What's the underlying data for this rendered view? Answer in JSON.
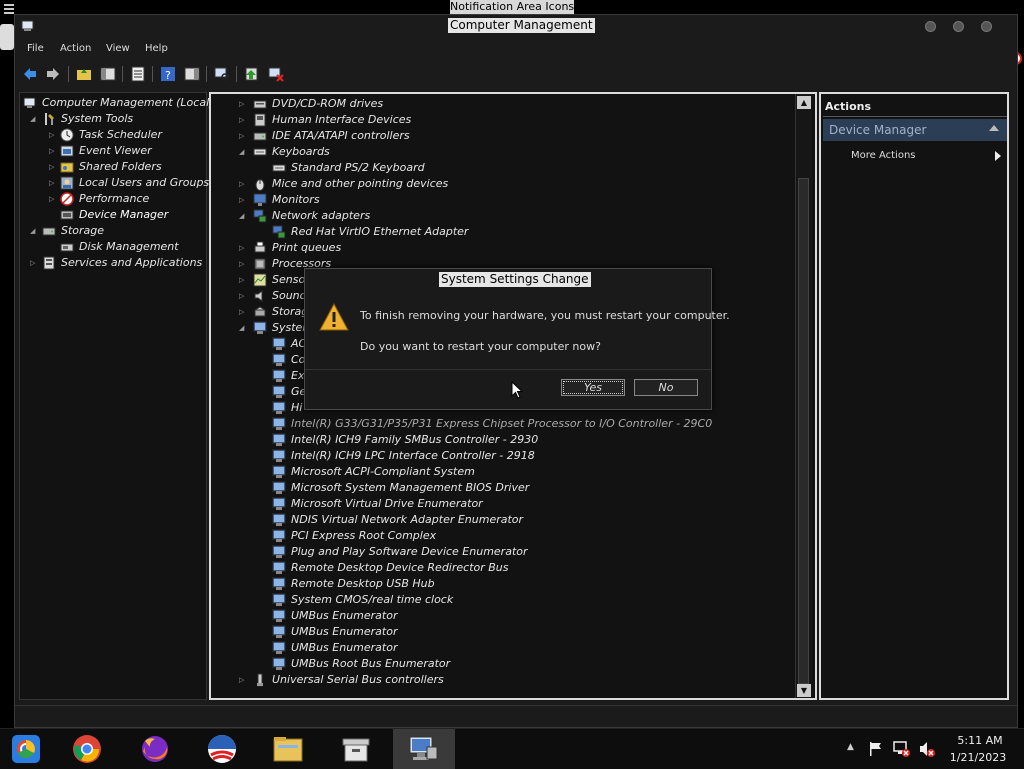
{
  "background": {
    "notification_tab": "Notification Area Icons"
  },
  "window": {
    "title": "Computer Management",
    "menu": [
      "File",
      "Action",
      "View",
      "Help"
    ]
  },
  "left_tree": [
    {
      "label": "Computer Management (Local)",
      "icon": "computer-management-icon"
    },
    {
      "label": "System Tools",
      "icon": "system-tools-icon"
    },
    {
      "label": "Task Scheduler",
      "icon": "task-scheduler-icon"
    },
    {
      "label": "Event Viewer",
      "icon": "event-viewer-icon"
    },
    {
      "label": "Shared Folders",
      "icon": "shared-folders-icon"
    },
    {
      "label": "Local Users and Groups",
      "icon": "local-users-icon"
    },
    {
      "label": "Performance",
      "icon": "performance-icon"
    },
    {
      "label": "Device Manager",
      "icon": "device-manager-icon"
    },
    {
      "label": "Storage",
      "icon": "storage-icon"
    },
    {
      "label": "Disk Management",
      "icon": "disk-management-icon"
    },
    {
      "label": "Services and Applications",
      "icon": "services-icon"
    }
  ],
  "device_tree": [
    {
      "label": "DVD/CD-ROM drives"
    },
    {
      "label": "Human Interface Devices"
    },
    {
      "label": "IDE ATA/ATAPI controllers"
    },
    {
      "label": "Keyboards"
    },
    {
      "label": "Standard PS/2 Keyboard"
    },
    {
      "label": "Mice and other pointing devices"
    },
    {
      "label": "Monitors"
    },
    {
      "label": "Network adapters"
    },
    {
      "label": "Red Hat VirtIO Ethernet Adapter"
    },
    {
      "label": "Print queues"
    },
    {
      "label": "Processors"
    },
    {
      "label": "Senso"
    },
    {
      "label": "Sound"
    },
    {
      "label": "Storag"
    },
    {
      "label": "Syster"
    },
    {
      "label": "AC"
    },
    {
      "label": "Co"
    },
    {
      "label": "Ex"
    },
    {
      "label": "Ge"
    },
    {
      "label": "Hi"
    },
    {
      "label": "Intel(R) G33/G31/P35/P31 Express Chipset Processor to I/O Controller - 29C0"
    },
    {
      "label": "Intel(R) ICH9 Family SMBus Controller - 2930"
    },
    {
      "label": "Intel(R) ICH9 LPC Interface Controller - 2918"
    },
    {
      "label": "Microsoft ACPI-Compliant System"
    },
    {
      "label": "Microsoft System Management BIOS Driver"
    },
    {
      "label": "Microsoft Virtual Drive Enumerator"
    },
    {
      "label": "NDIS Virtual Network Adapter Enumerator"
    },
    {
      "label": "PCI Express Root Complex"
    },
    {
      "label": "Plug and Play Software Device Enumerator"
    },
    {
      "label": "Remote Desktop Device Redirector Bus"
    },
    {
      "label": "Remote Desktop USB Hub"
    },
    {
      "label": "System CMOS/real time clock"
    },
    {
      "label": "UMBus Enumerator"
    },
    {
      "label": "UMBus Enumerator"
    },
    {
      "label": "UMBus Enumerator"
    },
    {
      "label": "UMBus Root Bus Enumerator"
    },
    {
      "label": "Universal Serial Bus controllers"
    }
  ],
  "actions": {
    "title": "Actions",
    "section": "Device Manager",
    "more": "More Actions"
  },
  "dialog": {
    "title": "System Settings Change",
    "message": "To finish removing your hardware, you must restart your computer.",
    "question": "Do you want to restart your computer now?",
    "yes": "Yes",
    "no": "No"
  },
  "taskbar": {
    "apps": [
      "chrome-os-icon",
      "chrome-icon",
      "firefox-icon",
      "obama-logo-icon",
      "file-explorer-icon",
      "archive-icon",
      "computer-management-icon"
    ],
    "clock_time": "5:11 AM",
    "clock_date": "1/21/2023"
  },
  "colors": {
    "accent_selection": "#2c3e55",
    "dialog_bg": "#1a1a1a",
    "window_bg": "#1b1b1b"
  }
}
